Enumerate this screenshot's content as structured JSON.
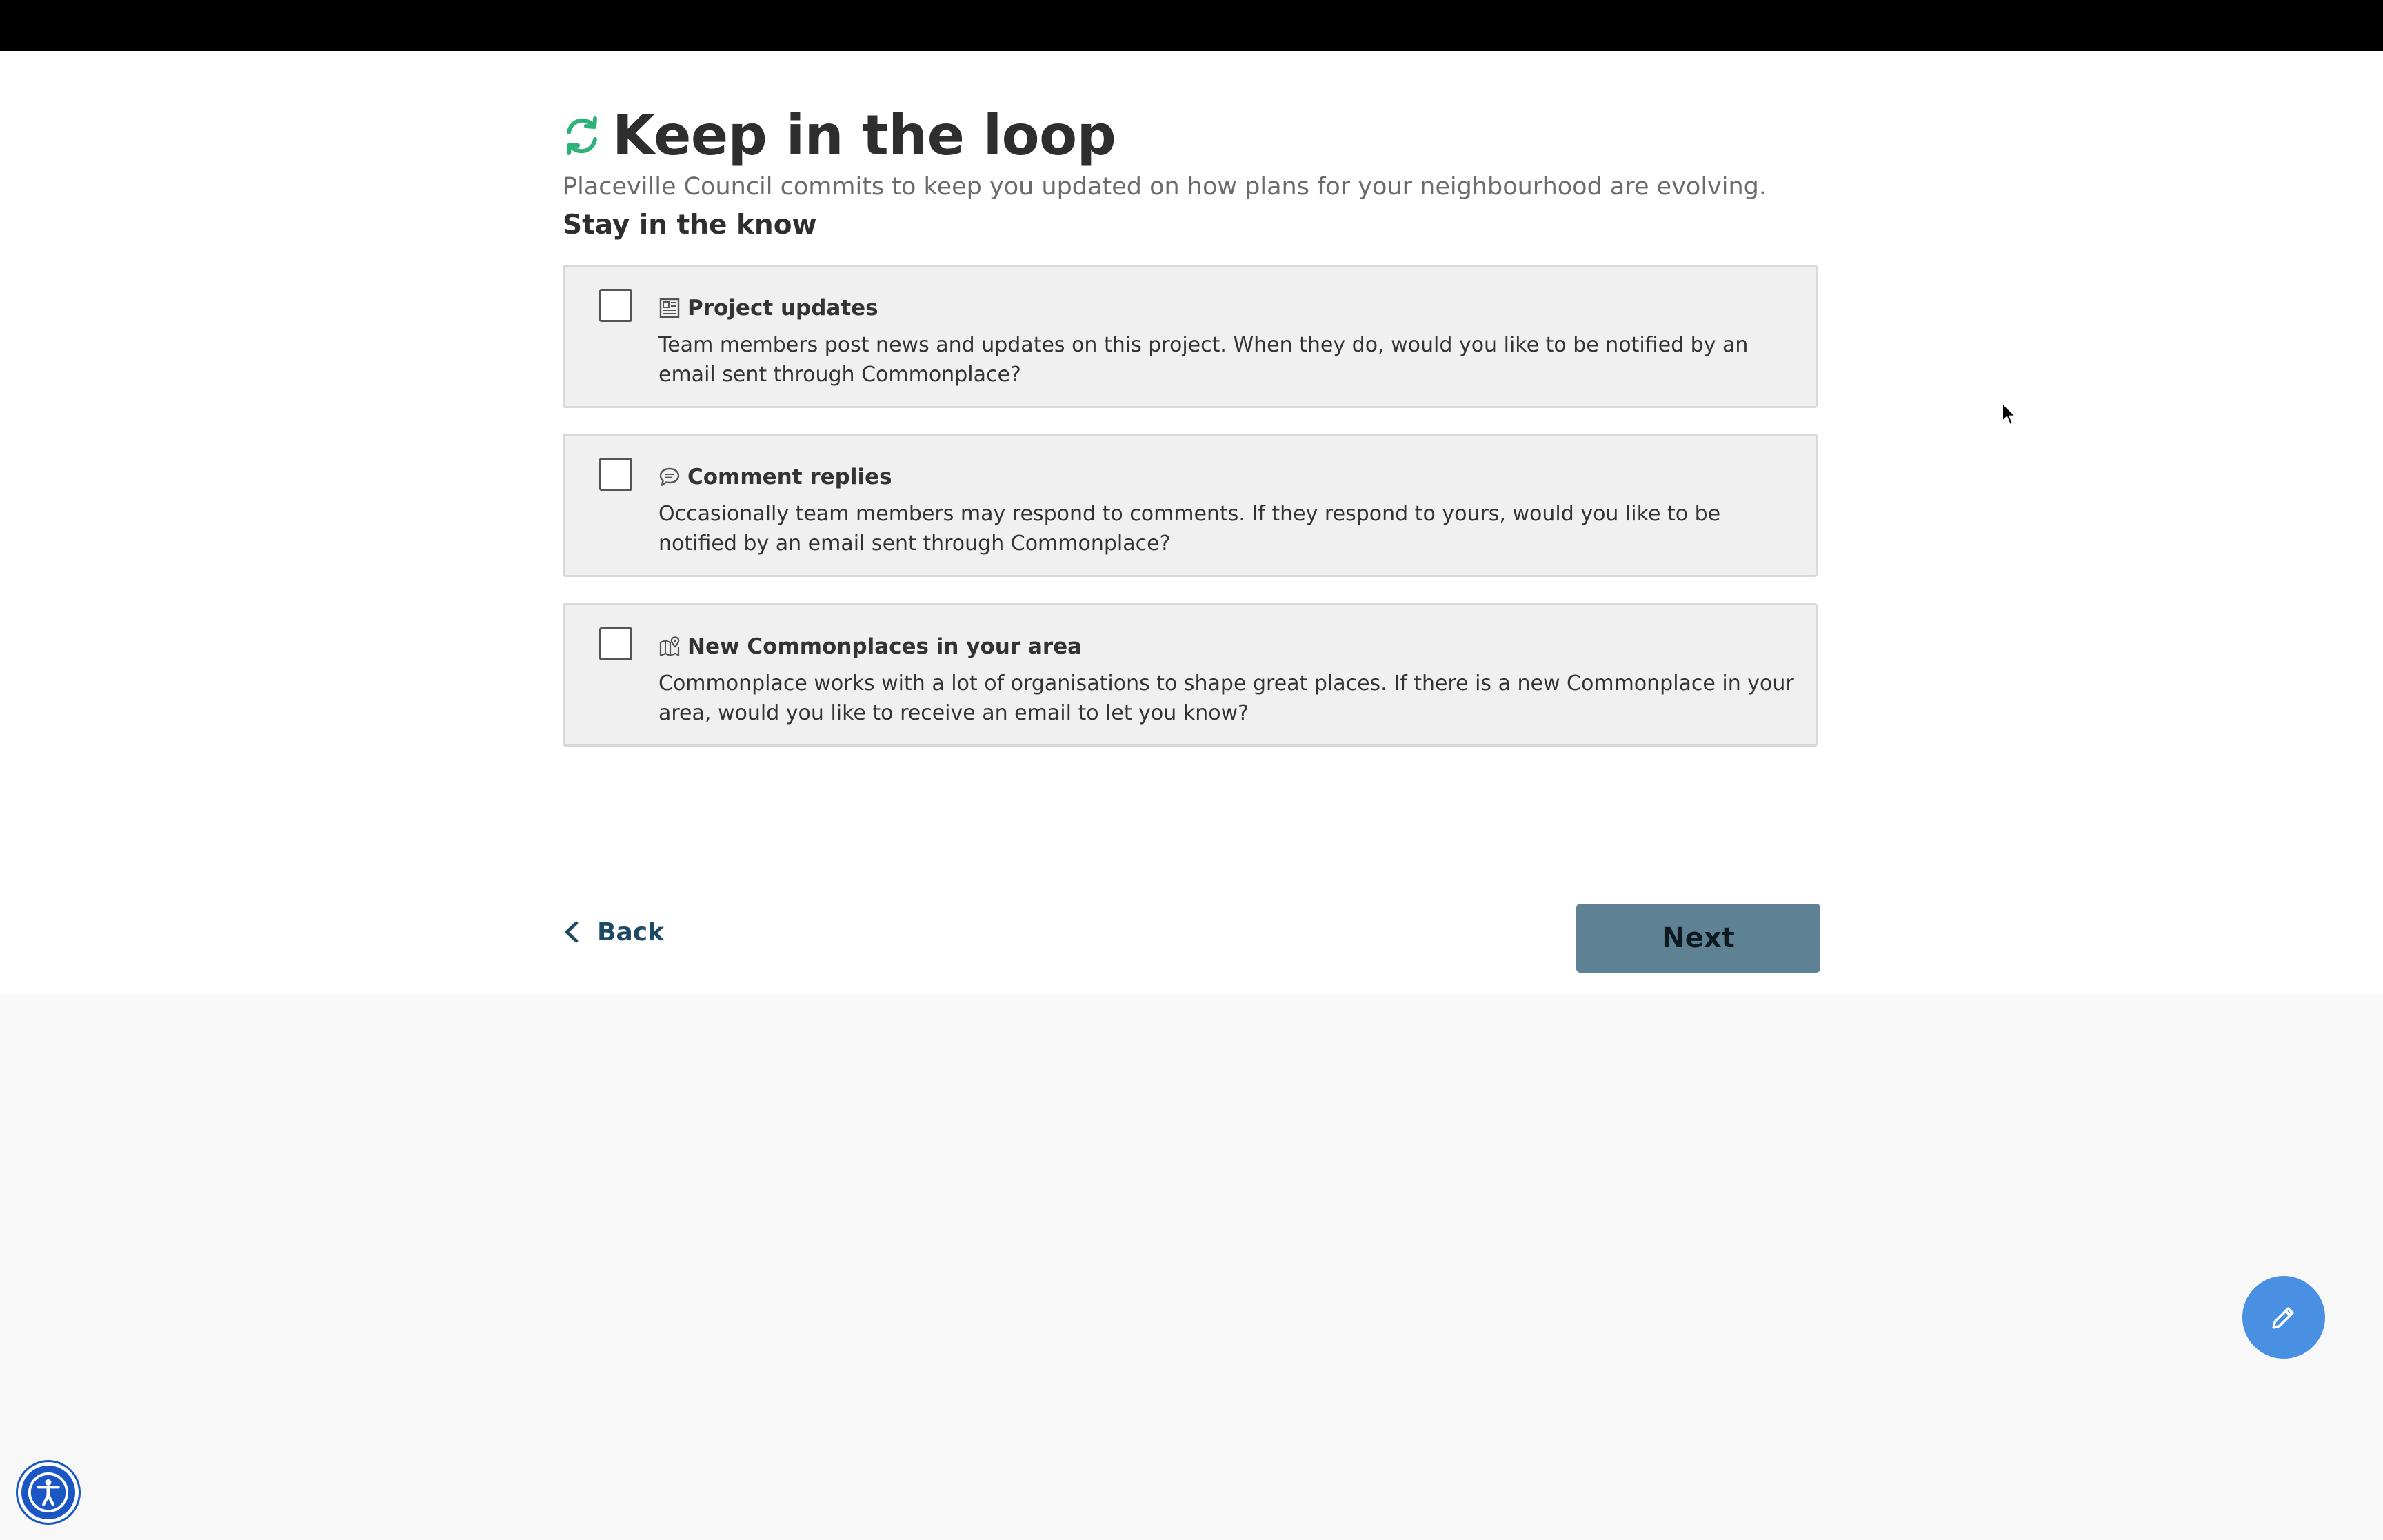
{
  "header": {
    "title": "Keep in the loop",
    "icon": "refresh-icon",
    "accent_color": "#2db37a",
    "subtitle": "Placeville Council commits to keep you updated on how plans for your neighbourhood are evolving."
  },
  "section": {
    "heading": "Stay in the know"
  },
  "options": [
    {
      "title": "Project updates",
      "icon": "newspaper-icon",
      "checked": false,
      "description": "Team members post news and updates on this project. When they do, would you like to be notified by an email sent through Commonplace?"
    },
    {
      "title": "Comment replies",
      "icon": "chat-bubble-icon",
      "checked": false,
      "description": "Occasionally team members may respond to comments. If they respond to yours, would you like to be notified by an email sent through Commonplace?"
    },
    {
      "title": "New Commonplaces in your area",
      "icon": "map-pin-icon",
      "checked": false,
      "description": "Commonplace works with a lot of organisations to shape great places. If there is a new Commonplace in your area, would you like to receive an email to let you know?"
    }
  ],
  "navigation": {
    "back_label": "Back",
    "next_label": "Next",
    "next_color": "#5e8294"
  },
  "floating": {
    "edit_icon": "pencil-icon",
    "edit_color": "#4a90e2",
    "accessibility_icon": "accessibility-icon",
    "accessibility_color": "#1a56c4"
  }
}
